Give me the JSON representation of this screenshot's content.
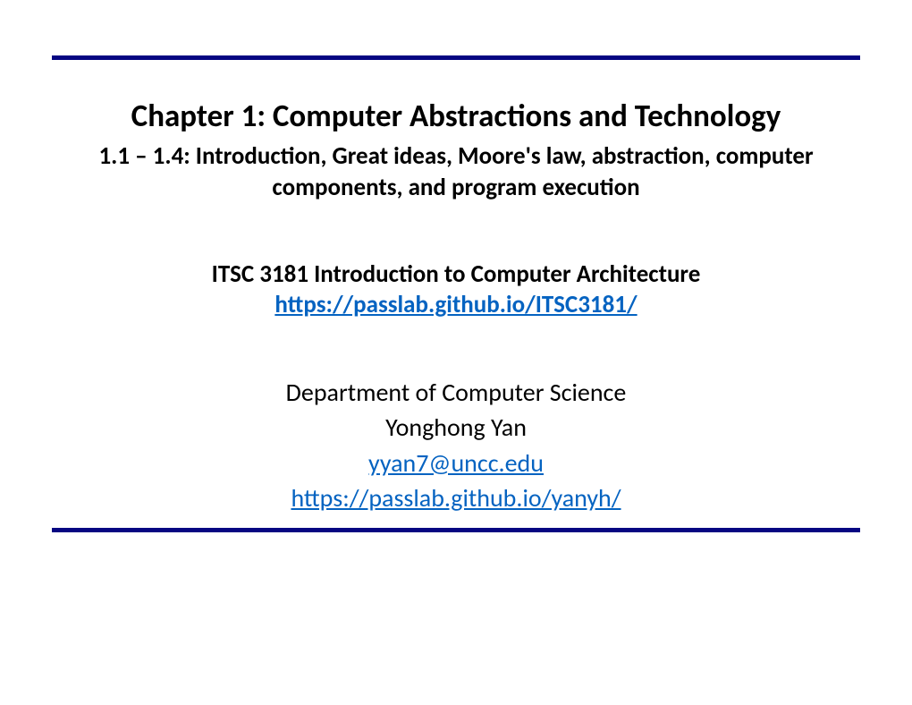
{
  "title": "Chapter 1: Computer Abstractions and Technology",
  "subtitle": "1.1 – 1.4: Introduction, Great ideas, Moore's law, abstraction, computer components, and program execution",
  "course": "ITSC 3181 Introduction to Computer Architecture",
  "course_link": "https://passlab.github.io/ITSC3181/",
  "department": "Department of Computer Science",
  "author": "Yonghong Yan",
  "email": "yyan7@uncc.edu",
  "homepage": "https://passlab.github.io/yanyh/"
}
